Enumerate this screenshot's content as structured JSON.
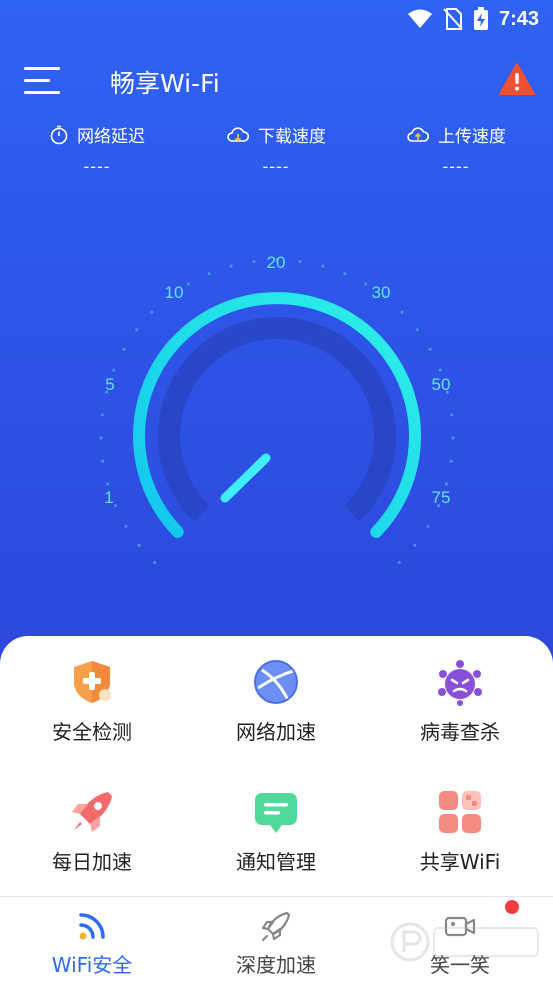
{
  "status_bar": {
    "time": "7:43"
  },
  "header": {
    "title": "畅享Wi-Fi"
  },
  "stats": {
    "latency": {
      "label": "网络延迟",
      "value": "----"
    },
    "download": {
      "label": "下载速度",
      "value": "----"
    },
    "upload": {
      "label": "上传速度",
      "value": "----"
    }
  },
  "gauge": {
    "labels": [
      "1",
      "5",
      "10",
      "20",
      "30",
      "50",
      "75"
    ]
  },
  "features": [
    {
      "label": "安全检测",
      "icon": "shield-plus-icon"
    },
    {
      "label": "网络加速",
      "icon": "globe-icon"
    },
    {
      "label": "病毒查杀",
      "icon": "virus-icon"
    },
    {
      "label": "每日加速",
      "icon": "rocket-icon"
    },
    {
      "label": "通知管理",
      "icon": "message-icon"
    },
    {
      "label": "共享WiFi",
      "icon": "grid-icon"
    }
  ],
  "bottom_nav": [
    {
      "label": "WiFi安全",
      "icon": "wifi-icon",
      "active": true
    },
    {
      "label": "深度加速",
      "icon": "rocket-outline-icon",
      "active": false
    },
    {
      "label": "笑一笑",
      "icon": "video-icon",
      "active": false
    }
  ],
  "colors": {
    "accent": "#2f6bf0",
    "gauge_arc": "#18d6f0",
    "alert": "#f0502e"
  }
}
